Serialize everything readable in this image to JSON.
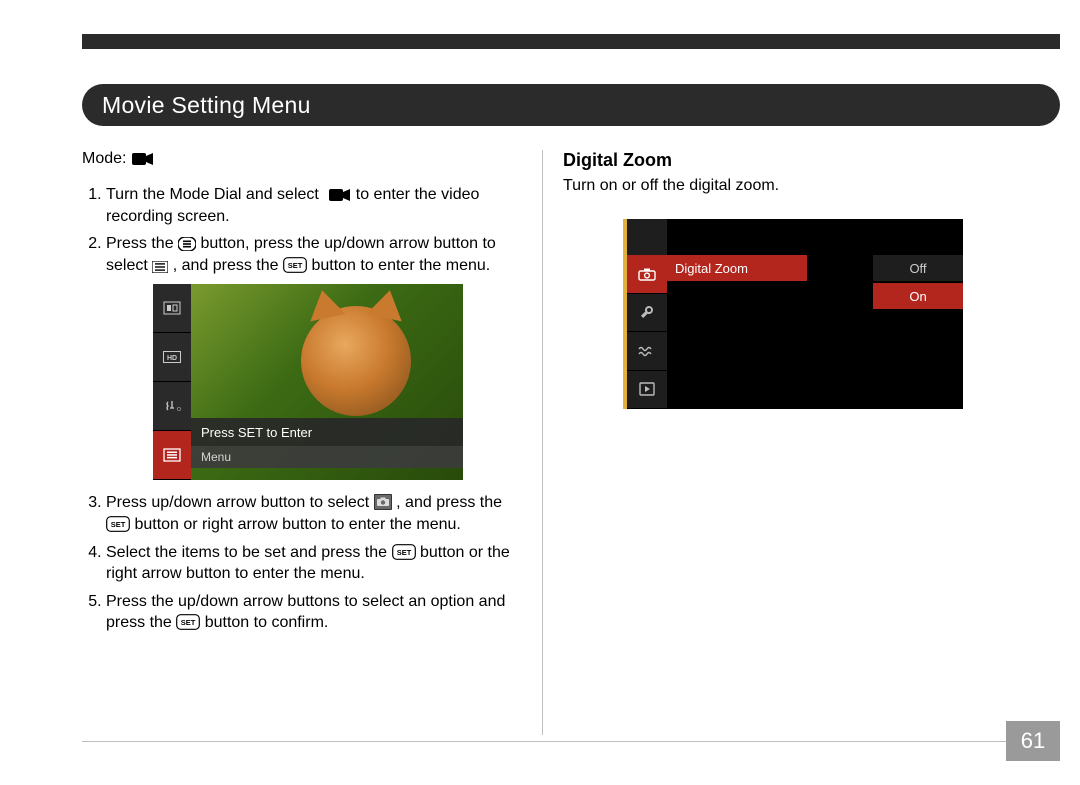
{
  "page": {
    "number": "61",
    "title": "Movie Setting Menu"
  },
  "left": {
    "mode_prefix": "Mode:",
    "steps": {
      "s1a": "Turn the Mode Dial and select ",
      "s1b": " to enter the video recording screen.",
      "s2a": "Press the ",
      "s2b": " button, press the up/down arrow button to select ",
      "s2c": " , and press the ",
      "s2d": " button to enter the menu.",
      "s3a": "Press up/down arrow button to select ",
      "s3b": " , and press the ",
      "s3c": " button or right arrow button to enter the menu.",
      "s4a": "Select the items to be set and press the ",
      "s4b": " button or the right arrow button to enter the menu.",
      "s5a": "Press the up/down arrow buttons to select an option and press the ",
      "s5b": " button to confirm."
    },
    "shot1": {
      "label_press_set": "Press SET to Enter",
      "label_menu": "Menu",
      "rail_icons": [
        "exposure",
        "hd",
        "vr-off",
        "menu"
      ]
    }
  },
  "right": {
    "heading": "Digital Zoom",
    "body": "Turn on or off the digital zoom.",
    "shot2": {
      "menu_item": "Digital Zoom",
      "opt_off": "Off",
      "opt_on": "On",
      "sidebar_icons": [
        "camera",
        "wrench",
        "waves",
        "playback"
      ]
    }
  },
  "icons": {
    "video": "video-camera",
    "list": "menu-list",
    "set": "SET",
    "cam_badge": "camera-badge"
  }
}
